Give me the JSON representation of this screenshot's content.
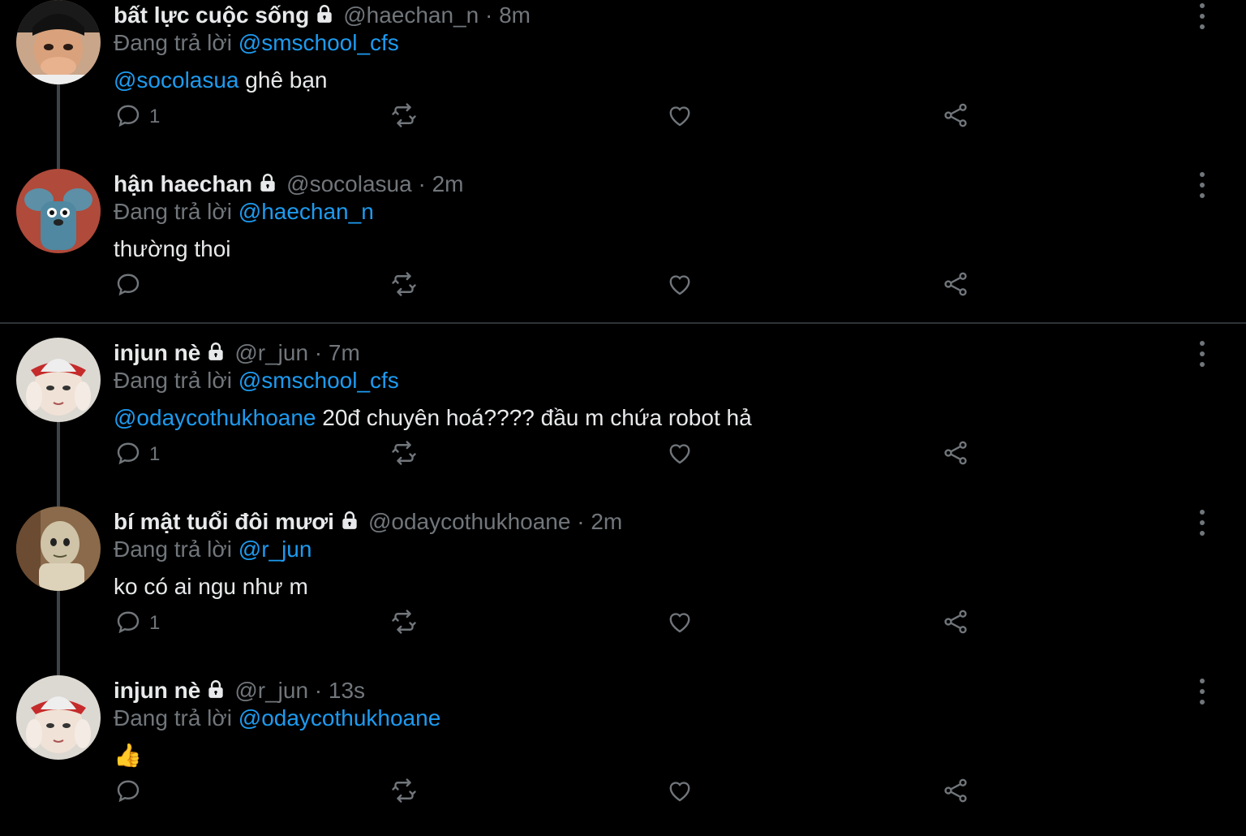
{
  "theme": {
    "background": "#000000",
    "text": "#e7e9ea",
    "muted": "#71767b",
    "accent": "#1d9bf0"
  },
  "labels": {
    "replying_to": "Đang trả lời"
  },
  "tweets": [
    {
      "display_name": "bất lực cuộc sống",
      "handle": "@haechan_n",
      "separator": "·",
      "time": "8m",
      "replying_to": "@smschool_cfs",
      "mention": "@socolasua",
      "text": " ghê bạn",
      "reply_count": "1",
      "avatar": "avatar-boy"
    },
    {
      "display_name": "hận haechan",
      "handle": "@socolasua",
      "separator": "·",
      "time": "2m",
      "replying_to": "@haechan_n",
      "mention": "",
      "text": "thường thoi",
      "reply_count": "",
      "avatar": "avatar-mouse"
    },
    {
      "display_name": "injun nè",
      "handle": "@r_jun",
      "separator": "·",
      "time": "7m",
      "replying_to": "@smschool_cfs",
      "mention": "@odaycothukhoane",
      "text": " 20đ chuyên hoá???? đầu m chứa robot hả",
      "reply_count": "1",
      "avatar": "avatar-cap"
    },
    {
      "display_name": "bí mật tuổi đôi mươi",
      "handle": "@odaycothukhoane",
      "separator": "·",
      "time": "2m",
      "replying_to": "@r_jun",
      "mention": "",
      "text": "ko có ai ngu như m",
      "reply_count": "1",
      "avatar": "avatar-doll"
    },
    {
      "display_name": "injun nè",
      "handle": "@r_jun",
      "separator": "·",
      "time": "13s",
      "replying_to": "@odaycothukhoane",
      "mention": "",
      "text": "👍",
      "reply_count": "",
      "avatar": "avatar-cap"
    }
  ],
  "icons": [
    "reply-icon",
    "retweet-icon",
    "like-icon",
    "share-icon",
    "lock-icon",
    "more-icon"
  ]
}
